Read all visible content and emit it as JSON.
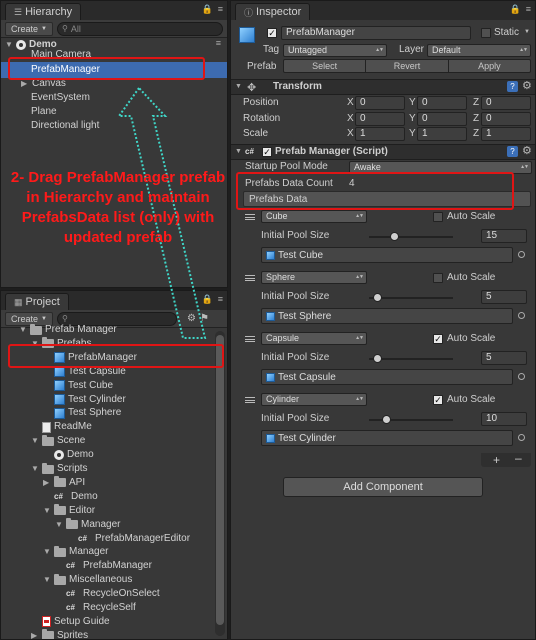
{
  "hierarchy": {
    "tab_label": "Hierarchy",
    "create_label": "Create",
    "search_placeholder": "All",
    "scene_name": "Demo",
    "items": [
      "Main Camera",
      "PrefabManager",
      "Canvas",
      "EventSystem",
      "Plane",
      "Directional light"
    ]
  },
  "annotation": {
    "text": "2- Drag PrefabManager prefab in Hierarchy and maintain PrefabsData list (only) with updated prefab"
  },
  "project": {
    "tab_label": "Project",
    "create_label": "Create",
    "items": [
      {
        "label": "Prefab Manager",
        "icon": "folder-icon"
      },
      {
        "label": "Prefabs",
        "icon": "folder-icon"
      },
      {
        "label": "PrefabManager",
        "icon": "prefab-icon"
      },
      {
        "label": "Test Capsule",
        "icon": "prefab-icon"
      },
      {
        "label": "Test Cube",
        "icon": "prefab-icon"
      },
      {
        "label": "Test Cylinder",
        "icon": "prefab-icon"
      },
      {
        "label": "Test Sphere",
        "icon": "prefab-icon"
      },
      {
        "label": "ReadMe",
        "icon": "document-icon"
      },
      {
        "label": "Scene",
        "icon": "folder-icon"
      },
      {
        "label": "Demo",
        "icon": "unity-scene-icon"
      },
      {
        "label": "Scripts",
        "icon": "folder-icon"
      },
      {
        "label": "API",
        "icon": "folder-icon"
      },
      {
        "label": "Demo",
        "icon": "script-icon"
      },
      {
        "label": "Editor",
        "icon": "folder-icon"
      },
      {
        "label": "Manager",
        "icon": "folder-icon"
      },
      {
        "label": "PrefabManagerEditor",
        "icon": "script-icon"
      },
      {
        "label": "Manager",
        "icon": "folder-icon"
      },
      {
        "label": "PrefabManager",
        "icon": "script-icon"
      },
      {
        "label": "Miscellaneous",
        "icon": "folder-icon"
      },
      {
        "label": "RecycleOnSelect",
        "icon": "script-icon"
      },
      {
        "label": "RecycleSelf",
        "icon": "script-icon"
      },
      {
        "label": "Setup Guide",
        "icon": "pdf-icon"
      },
      {
        "label": "Sprites",
        "icon": "folder-icon"
      }
    ]
  },
  "inspector": {
    "tab_label": "Inspector",
    "object_name": "PrefabManager",
    "static_label": "Static",
    "tag_label": "Tag",
    "tag_value": "Untagged",
    "layer_label": "Layer",
    "layer_value": "Default",
    "prefab_label": "Prefab",
    "select_label": "Select",
    "revert_label": "Revert",
    "apply_label": "Apply",
    "transform": {
      "title": "Transform",
      "rows": [
        {
          "label": "Position",
          "x": "0",
          "y": "0",
          "z": "0"
        },
        {
          "label": "Rotation",
          "x": "0",
          "y": "0",
          "z": "0"
        },
        {
          "label": "Scale",
          "x": "1",
          "y": "1",
          "z": "1"
        }
      ],
      "axis_x": "X",
      "axis_y": "Y",
      "axis_z": "Z"
    },
    "script": {
      "title": "Prefab Manager (Script)",
      "startup_label": "Startup Pool Mode",
      "startup_value": "Awake",
      "count_label": "Prefabs Data Count",
      "count_value": "4",
      "list_label": "Prefabs Data",
      "auto_scale_label": "Auto Scale",
      "pool_size_label": "Initial Pool Size",
      "entries": [
        {
          "shape": "Cube",
          "auto_scale": false,
          "pool_size": "15",
          "slider": 0.3,
          "prefab": "Test Cube"
        },
        {
          "shape": "Sphere",
          "auto_scale": false,
          "pool_size": "5",
          "slider": 0.1,
          "prefab": "Test Sphere"
        },
        {
          "shape": "Capsule",
          "auto_scale": true,
          "pool_size": "5",
          "slider": 0.1,
          "prefab": "Test Capsule"
        },
        {
          "shape": "Cylinder",
          "auto_scale": true,
          "pool_size": "10",
          "slider": 0.2,
          "prefab": "Test Cylinder"
        }
      ]
    },
    "add_component_label": "Add Component"
  }
}
